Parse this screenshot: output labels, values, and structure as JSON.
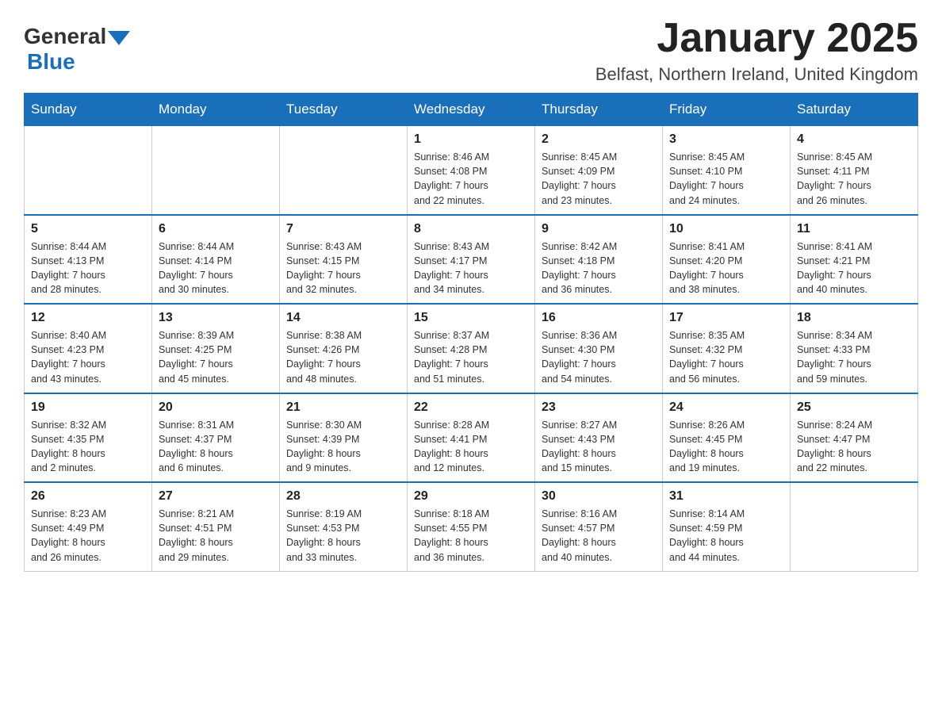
{
  "logo": {
    "text_general": "General",
    "text_blue": "Blue"
  },
  "title": "January 2025",
  "subtitle": "Belfast, Northern Ireland, United Kingdom",
  "days_of_week": [
    "Sunday",
    "Monday",
    "Tuesday",
    "Wednesday",
    "Thursday",
    "Friday",
    "Saturday"
  ],
  "weeks": [
    [
      {
        "day": "",
        "info": ""
      },
      {
        "day": "",
        "info": ""
      },
      {
        "day": "",
        "info": ""
      },
      {
        "day": "1",
        "info": "Sunrise: 8:46 AM\nSunset: 4:08 PM\nDaylight: 7 hours\nand 22 minutes."
      },
      {
        "day": "2",
        "info": "Sunrise: 8:45 AM\nSunset: 4:09 PM\nDaylight: 7 hours\nand 23 minutes."
      },
      {
        "day": "3",
        "info": "Sunrise: 8:45 AM\nSunset: 4:10 PM\nDaylight: 7 hours\nand 24 minutes."
      },
      {
        "day": "4",
        "info": "Sunrise: 8:45 AM\nSunset: 4:11 PM\nDaylight: 7 hours\nand 26 minutes."
      }
    ],
    [
      {
        "day": "5",
        "info": "Sunrise: 8:44 AM\nSunset: 4:13 PM\nDaylight: 7 hours\nand 28 minutes."
      },
      {
        "day": "6",
        "info": "Sunrise: 8:44 AM\nSunset: 4:14 PM\nDaylight: 7 hours\nand 30 minutes."
      },
      {
        "day": "7",
        "info": "Sunrise: 8:43 AM\nSunset: 4:15 PM\nDaylight: 7 hours\nand 32 minutes."
      },
      {
        "day": "8",
        "info": "Sunrise: 8:43 AM\nSunset: 4:17 PM\nDaylight: 7 hours\nand 34 minutes."
      },
      {
        "day": "9",
        "info": "Sunrise: 8:42 AM\nSunset: 4:18 PM\nDaylight: 7 hours\nand 36 minutes."
      },
      {
        "day": "10",
        "info": "Sunrise: 8:41 AM\nSunset: 4:20 PM\nDaylight: 7 hours\nand 38 minutes."
      },
      {
        "day": "11",
        "info": "Sunrise: 8:41 AM\nSunset: 4:21 PM\nDaylight: 7 hours\nand 40 minutes."
      }
    ],
    [
      {
        "day": "12",
        "info": "Sunrise: 8:40 AM\nSunset: 4:23 PM\nDaylight: 7 hours\nand 43 minutes."
      },
      {
        "day": "13",
        "info": "Sunrise: 8:39 AM\nSunset: 4:25 PM\nDaylight: 7 hours\nand 45 minutes."
      },
      {
        "day": "14",
        "info": "Sunrise: 8:38 AM\nSunset: 4:26 PM\nDaylight: 7 hours\nand 48 minutes."
      },
      {
        "day": "15",
        "info": "Sunrise: 8:37 AM\nSunset: 4:28 PM\nDaylight: 7 hours\nand 51 minutes."
      },
      {
        "day": "16",
        "info": "Sunrise: 8:36 AM\nSunset: 4:30 PM\nDaylight: 7 hours\nand 54 minutes."
      },
      {
        "day": "17",
        "info": "Sunrise: 8:35 AM\nSunset: 4:32 PM\nDaylight: 7 hours\nand 56 minutes."
      },
      {
        "day": "18",
        "info": "Sunrise: 8:34 AM\nSunset: 4:33 PM\nDaylight: 7 hours\nand 59 minutes."
      }
    ],
    [
      {
        "day": "19",
        "info": "Sunrise: 8:32 AM\nSunset: 4:35 PM\nDaylight: 8 hours\nand 2 minutes."
      },
      {
        "day": "20",
        "info": "Sunrise: 8:31 AM\nSunset: 4:37 PM\nDaylight: 8 hours\nand 6 minutes."
      },
      {
        "day": "21",
        "info": "Sunrise: 8:30 AM\nSunset: 4:39 PM\nDaylight: 8 hours\nand 9 minutes."
      },
      {
        "day": "22",
        "info": "Sunrise: 8:28 AM\nSunset: 4:41 PM\nDaylight: 8 hours\nand 12 minutes."
      },
      {
        "day": "23",
        "info": "Sunrise: 8:27 AM\nSunset: 4:43 PM\nDaylight: 8 hours\nand 15 minutes."
      },
      {
        "day": "24",
        "info": "Sunrise: 8:26 AM\nSunset: 4:45 PM\nDaylight: 8 hours\nand 19 minutes."
      },
      {
        "day": "25",
        "info": "Sunrise: 8:24 AM\nSunset: 4:47 PM\nDaylight: 8 hours\nand 22 minutes."
      }
    ],
    [
      {
        "day": "26",
        "info": "Sunrise: 8:23 AM\nSunset: 4:49 PM\nDaylight: 8 hours\nand 26 minutes."
      },
      {
        "day": "27",
        "info": "Sunrise: 8:21 AM\nSunset: 4:51 PM\nDaylight: 8 hours\nand 29 minutes."
      },
      {
        "day": "28",
        "info": "Sunrise: 8:19 AM\nSunset: 4:53 PM\nDaylight: 8 hours\nand 33 minutes."
      },
      {
        "day": "29",
        "info": "Sunrise: 8:18 AM\nSunset: 4:55 PM\nDaylight: 8 hours\nand 36 minutes."
      },
      {
        "day": "30",
        "info": "Sunrise: 8:16 AM\nSunset: 4:57 PM\nDaylight: 8 hours\nand 40 minutes."
      },
      {
        "day": "31",
        "info": "Sunrise: 8:14 AM\nSunset: 4:59 PM\nDaylight: 8 hours\nand 44 minutes."
      },
      {
        "day": "",
        "info": ""
      }
    ]
  ]
}
